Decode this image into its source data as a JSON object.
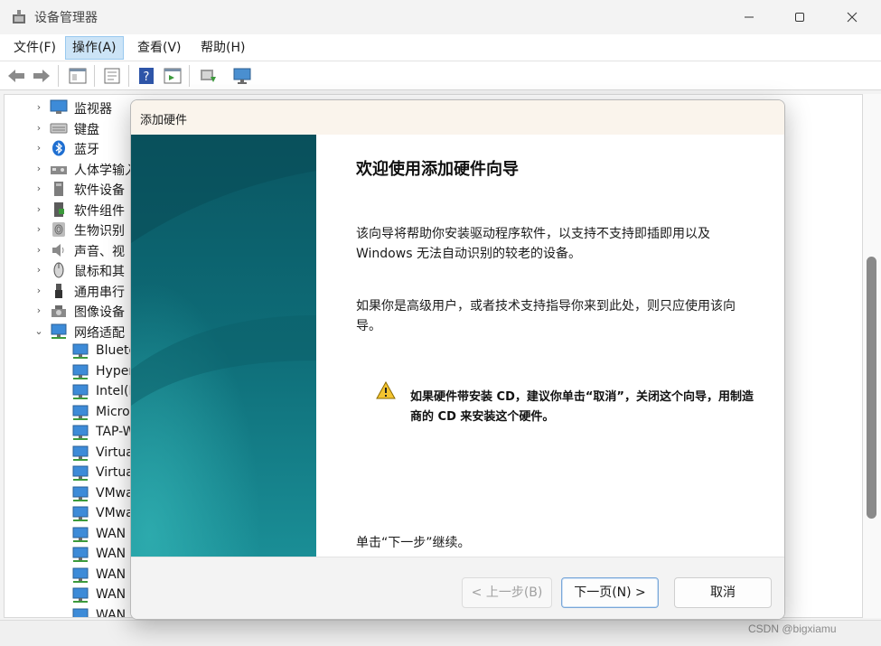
{
  "window": {
    "title": "设备管理器",
    "controls": {
      "minimize": "minimize-icon",
      "maximize": "maximize-icon",
      "close": "close-icon"
    }
  },
  "menu": {
    "items": [
      {
        "label": "文件(F)"
      },
      {
        "label": "操作(A)",
        "active": true
      },
      {
        "label": "查看(V)"
      },
      {
        "label": "帮助(H)"
      }
    ]
  },
  "toolbar": {
    "icons": [
      "back-arrow-icon",
      "forward-arrow-icon",
      "properties-icon",
      "scan-icon",
      "help-icon",
      "show-hidden-icon",
      "update-driver-icon",
      "monitor-icon"
    ]
  },
  "tree": {
    "items": [
      {
        "label": "监视器",
        "expanded": false,
        "icon": "monitor-icon"
      },
      {
        "label": "键盘",
        "expanded": false,
        "icon": "keyboard-icon"
      },
      {
        "label": "蓝牙",
        "expanded": false,
        "icon": "bluetooth-icon"
      },
      {
        "label": "人体学输入",
        "expanded": false,
        "icon": "hid-icon"
      },
      {
        "label": "软件设备",
        "expanded": false,
        "icon": "software-device-icon"
      },
      {
        "label": "软件组件",
        "expanded": false,
        "icon": "software-component-icon"
      },
      {
        "label": "生物识别",
        "expanded": false,
        "icon": "fingerprint-icon"
      },
      {
        "label": "声音、视",
        "expanded": false,
        "icon": "speaker-icon"
      },
      {
        "label": "鼠标和其",
        "expanded": false,
        "icon": "mouse-icon"
      },
      {
        "label": "通用串行",
        "expanded": false,
        "icon": "usb-icon"
      },
      {
        "label": "图像设备",
        "expanded": false,
        "icon": "camera-icon"
      },
      {
        "label": "网络适配",
        "expanded": true,
        "icon": "network-adapter-icon"
      }
    ],
    "children": [
      {
        "label": "Bluetoo"
      },
      {
        "label": "Hyper-"
      },
      {
        "label": "Intel(R"
      },
      {
        "label": "Micros"
      },
      {
        "label": "TAP-W"
      },
      {
        "label": "Virtua"
      },
      {
        "label": "Virtua"
      },
      {
        "label": "VMwa"
      },
      {
        "label": "VMwa"
      },
      {
        "label": "WAN"
      },
      {
        "label": "WAN"
      },
      {
        "label": "WAN"
      },
      {
        "label": "WAN"
      },
      {
        "label": "WAN"
      }
    ]
  },
  "dialog": {
    "title": "添加硬件",
    "heading": "欢迎使用添加硬件向导",
    "para1": "该向导将帮助你安装驱动程序软件，以支持不支持即插即用以及 Windows 无法自动识别的较老的设备。",
    "para2": "如果你是高级用户，或者技术支持指导你来到此处，则只应使用该向导。",
    "warning": "如果硬件带安装 CD，建议你单击“取消”，关闭这个向导，用制造商的 CD 来安装这个硬件。",
    "continue_hint": "单击“下一步”继续。",
    "buttons": {
      "back": "< 上一步(B)",
      "next": "下一页(N) >",
      "cancel": "取消"
    },
    "warning_icon": "warning-icon"
  },
  "watermark": "CSDN @bigxiamu",
  "colors": {
    "accent": "#0078d4",
    "side_panel_top": "#0b5e69",
    "side_panel_bottom": "#1a8d95",
    "selected_menu": "#cce4f7"
  }
}
